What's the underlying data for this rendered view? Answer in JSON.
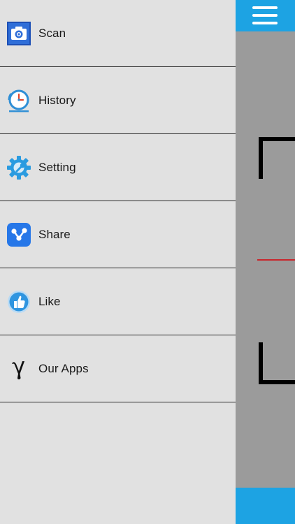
{
  "menu": {
    "items": [
      {
        "label": "Scan",
        "icon": "camera-icon"
      },
      {
        "label": "History",
        "icon": "clock-icon"
      },
      {
        "label": "Setting",
        "icon": "gear-wrench-icon"
      },
      {
        "label": "Share",
        "icon": "share-icon"
      },
      {
        "label": "Like",
        "icon": "thumbs-up-icon"
      },
      {
        "label": "Our Apps",
        "icon": "gamma-icon"
      }
    ]
  },
  "scanner": {
    "menu_icon": "hamburger-icon"
  },
  "colors": {
    "accent": "#1da3e3",
    "drawer_bg": "#e1e1e1",
    "viewfinder_bg": "#9b9b9b",
    "scan_line": "#c9252c"
  }
}
